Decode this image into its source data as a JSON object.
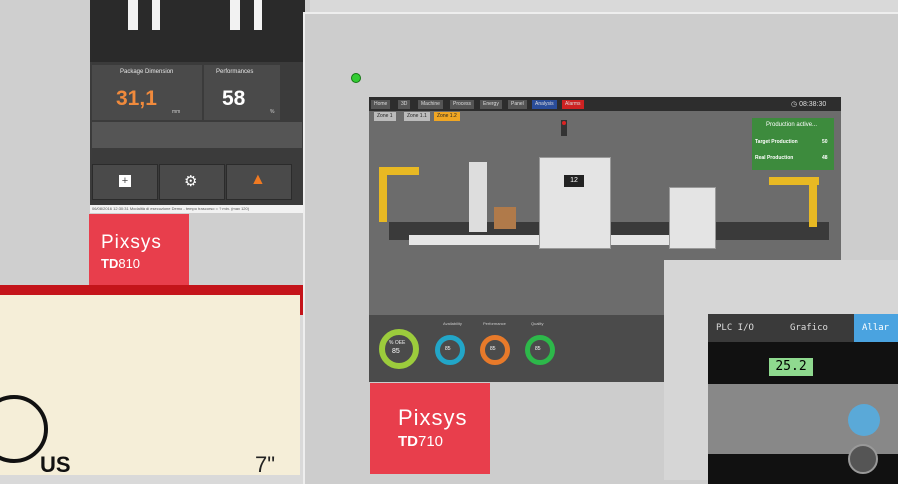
{
  "td810": {
    "pane1_label": "Package Dimension",
    "pane1_value": "31,1",
    "pane1_unit": "mm",
    "pane2_label": "Performances",
    "pane2_value": "58",
    "pane2_unit": "%",
    "status_line": "06/08/2016 12:30:31 Modalità di esecuzione Demo - tempo trascorso = ? min. (max 120)",
    "brand": "Pixsys",
    "model_bold": "TD",
    "model_num": "810"
  },
  "td710": {
    "tabs": [
      "Home",
      "3D",
      "Machine",
      "Process",
      "Energy",
      "Panel",
      "Analysis",
      "Alarms"
    ],
    "subtabs": [
      "Zone 1",
      "Zone 1.1",
      "Zone 1.2"
    ],
    "clock": "08:38:30",
    "production_title": "Production active...",
    "target_label": "Target Production",
    "target_value": "50",
    "real_label": "Real Production",
    "real_value": "48",
    "oee_label": "% OEE",
    "oee_value": "85",
    "gauges": [
      {
        "label": "Availability",
        "value": "85",
        "color": "#22a6c8"
      },
      {
        "label": "Performance",
        "value": "85",
        "color": "#e87a2a"
      },
      {
        "label": "Quality",
        "value": "85",
        "color": "#2db84a"
      }
    ],
    "oee_color": "#9ccc3c",
    "lcd_small": "12",
    "brand": "Pixsys",
    "model_bold": "TD",
    "model_num": "710"
  },
  "td3": {
    "tabs": [
      "PLC I/O",
      "Grafico",
      "Allar"
    ],
    "lcd": "25.2"
  },
  "box": {
    "cert": "US",
    "size": "7\""
  }
}
